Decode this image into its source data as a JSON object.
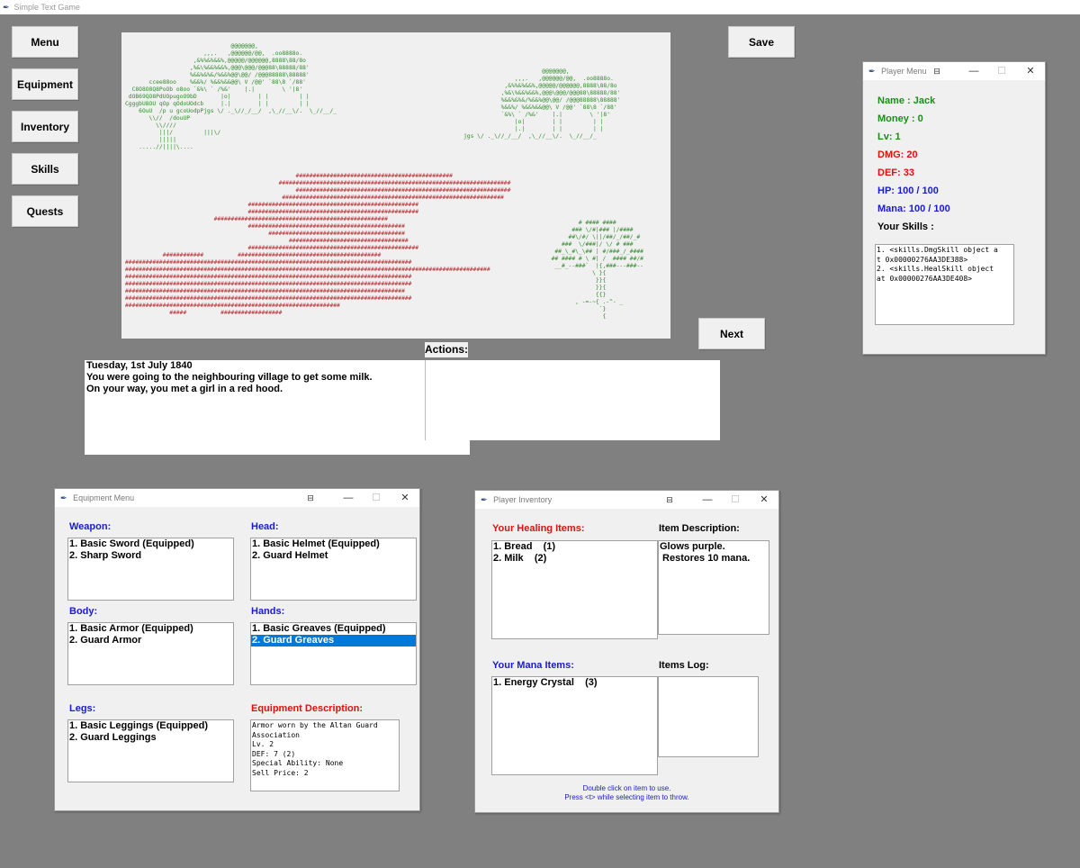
{
  "app": {
    "title": "Simple Text Game"
  },
  "left_menu": {
    "menu": "Menu",
    "equipment": "Equipment",
    "inventory": "Inventory",
    "skills": "Skills",
    "quests": "Quests"
  },
  "buttons": {
    "save": "Save",
    "next": "Next"
  },
  "actions_label": "Actions:",
  "story": {
    "lines": [
      "Tuesday, 1st July 1840",
      "You were going to the neighbouring village to get some milk.",
      "On your way, you met a girl in a red hood."
    ]
  },
  "scene_art": {
    "tree_left": "                               @@@@@@@,\n                       ,,,.   ,@@@@@@/@@,  .oo8888o.\n                    ,&%%&%&&%,@@@@@/@@@@@@,8888\\88/8o\n                   ,%&\\%&&%&&%,@@@\\@@@/@@@88\\88888/88'\n                   %&&%&%&/%&&%@@\\@@/ /@@@88888\\88888'\n       ccee88oo    %&&%/ %&&%&&@@\\ V /@@' `88\\8 `/88'\n  C8O8O8Q8PoOb o8oo `&%\\ ` /%&'    |.|        \\ '|8'\n dOB69QO8PdUOpugoO9bD       |o|        | |         | |\nCgggbU8OU qOp qOdoUOdcb     |.|        | |         | |\n    6OuU  /p u gcoUodpPjgs \\/ ._\\//_/__/  ,\\_//__\\/.  \\_//__/_\n       \\\\//  /douUP\n         \\\\////\n          |||/         |||\\/\n          |||||\n    .....//||||\\....",
    "tree_right": "                       @@@@@@@,\n               ,,,.   ,@@@@@@/@@,  .oo8888o.\n            ,&%%&%&&%,@@@@@/@@@@@@,8888\\88/8o\n           ,%&\\%&&%&&%,@@@\\@@@/@@@88\\88888/88'\n           %&&%&%&/%&&%@@\\@@/ /@@@88888\\88888'\n           %&&%/ %&&%&&@@\\ V /@@' `88\\8 `/88'\n           `&%\\ ` /%&'    |.|        \\ '|8'\n               |o|        | |         | |\n               |.|        | |         | |\njgs \\/ ._\\//_/__/  ,\\_//__\\/.  \\_//__/_",
    "bricks": "                                                  ##############################################\n                                             ####################################################################\n                                                  ###############################################################\n                                              #################################################################\n                                    ##################################################\n                                    ##################################################\n                          ###################################################\n                                    ##############################################\n                                          ########################################\n                                                ###################################\n                                    ##################################################\n           ############          ##########################################\n####################################################################################\n###########################################################################################################\n####################################################################################\n####################################################################################\n##################################################################################\n####################################################################################\n###############################################################\n             #####          ##################",
    "tree_small": "          # #### ####\n        ### \\/#|### |/####\n       ##\\/#/ \\||/##/_/##/_#\n     ###  \\/###|/ \\/ # ###\n   ##_\\_#\\_\\## | #/###_/_####\n  ## #### # \\ #| /  #### ##/#\n   __#_--###`  |{,###---###--\n              \\ }{\n               }}{\n               }}{\n               {{}\n         , -=-~{ .-^- _\n                `}\n                 {"
  },
  "player_menu": {
    "title": "Player Menu",
    "name": "Name : Jack",
    "money": "Money : 0",
    "level": "Lv: 1",
    "dmg": "DMG: 20",
    "def": "DEF: 33",
    "hp": "HP: 100 / 100",
    "mana": "Mana: 100 / 100",
    "skills_label": "Your Skills :",
    "skills_text": "1. <skills.DmgSkill object a\nt 0x00000276AA3DE388>\n2. <skills.HealSkill object \nat 0x00000276AA3DE408>"
  },
  "equipment_menu": {
    "title": "Equipment Menu",
    "weapon": {
      "label": "Weapon:",
      "items": [
        "1. Basic Sword (Equipped)",
        "2. Sharp Sword"
      ]
    },
    "head": {
      "label": "Head:",
      "items": [
        "1. Basic Helmet (Equipped)",
        "2. Guard Helmet"
      ]
    },
    "body": {
      "label": "Body:",
      "items": [
        "1. Basic Armor (Equipped)",
        "2. Guard Armor"
      ]
    },
    "hands": {
      "label": "Hands:",
      "items": [
        "1. Basic Greaves (Equipped)",
        "2. Guard Greaves"
      ],
      "selected_index": 1
    },
    "legs": {
      "label": "Legs:",
      "items": [
        "1. Basic Leggings (Equipped)",
        "2. Guard Leggings"
      ]
    },
    "description_label": "Equipment Description:",
    "description_text": "Armor worn by the Altan Guard\nAssociation\nLv. 2\nDEF: 7 (2)\nSpecial Ability: None\nSell Price: 2"
  },
  "inventory": {
    "title": "Player Inventory",
    "healing_label": "Your Healing Items:",
    "healing_items": [
      "1. Bread    (1)",
      "2. Milk    (2)"
    ],
    "item_desc_label": "Item Description:",
    "item_desc_lines": [
      "Glows purple.",
      " Restores 10 mana."
    ],
    "mana_label": "Your Mana Items:",
    "mana_items": [
      "1. Energy Crystal    (3)"
    ],
    "log_label": "Items Log:",
    "hint_1": "Double click on item to use.",
    "hint_2": "Press <t> while selecting item to throw."
  },
  "window_controls": {
    "minimize": "—",
    "maximize": "☐",
    "close": "✕",
    "extra": "⊟"
  },
  "colors": {
    "background": "#808080",
    "tree_green": "#2f8a2a",
    "brick_red": "#b3262b",
    "selection": "#0078d7",
    "stat_green": "#1e8a1e",
    "stat_red": "#e01010",
    "stat_blue": "#1a1ad0"
  }
}
